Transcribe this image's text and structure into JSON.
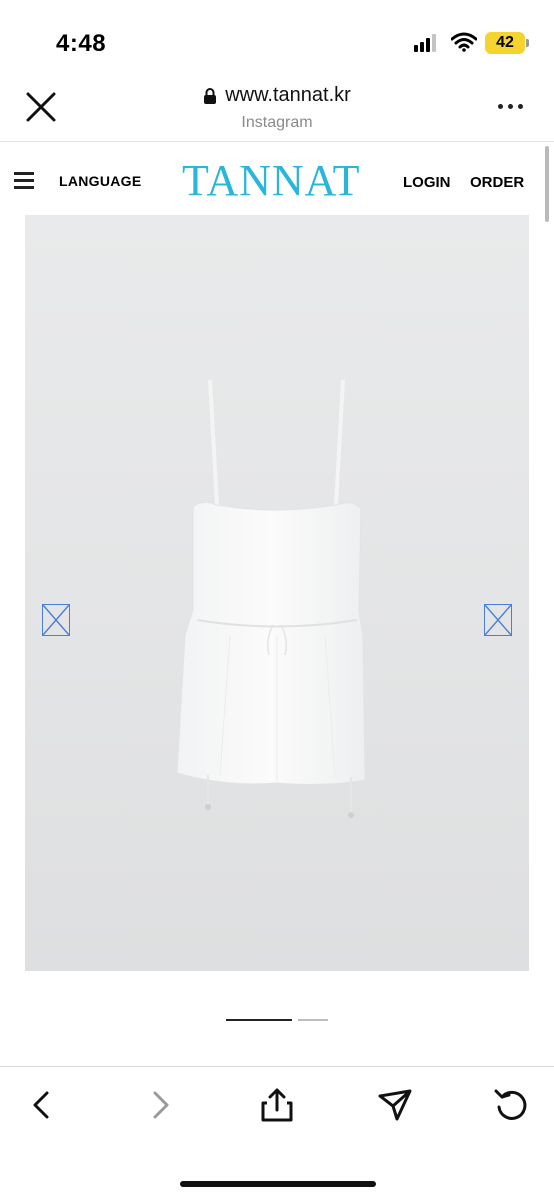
{
  "status_bar": {
    "time": "4:48",
    "battery": "42",
    "icons": [
      "cellular-signal-icon",
      "wifi-icon",
      "battery-icon"
    ]
  },
  "browser": {
    "url": "www.tannat.kr",
    "source": "Instagram",
    "icons": [
      "close-icon",
      "lock-icon",
      "more-icon"
    ]
  },
  "site_nav": {
    "language": "LANGUAGE",
    "logo": "TANNAT",
    "login": "LOGIN",
    "order": "ORDER",
    "brand_color": "#29b6d8"
  },
  "carousel": {
    "current_index": 1,
    "total": 2
  },
  "toolbar": {
    "icons": [
      "back-icon",
      "forward-icon",
      "share-icon",
      "send-icon",
      "reload-icon"
    ]
  }
}
